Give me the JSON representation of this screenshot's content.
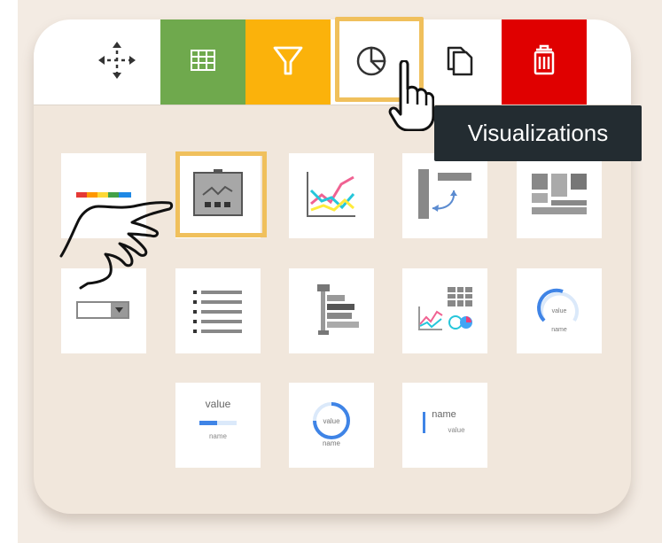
{
  "toolbar": {
    "items": [
      {
        "name": "move",
        "icon": "move-arrows-icon"
      },
      {
        "name": "table",
        "icon": "table-icon",
        "color": "#6fa94d"
      },
      {
        "name": "filter",
        "icon": "filter-icon",
        "color": "#fbb20b"
      },
      {
        "name": "visualizations",
        "icon": "pie-chart-icon",
        "selected": true
      },
      {
        "name": "copy",
        "icon": "copy-icon"
      },
      {
        "name": "delete",
        "icon": "trash-icon",
        "color": "#e00000"
      }
    ],
    "tooltip": "Visualizations"
  },
  "gallery": {
    "tiles": [
      {
        "icon": "color-bar-icon"
      },
      {
        "icon": "sparkline-icon",
        "highlighted": true
      },
      {
        "icon": "line-chart-icon"
      },
      {
        "icon": "flow-icon"
      },
      {
        "icon": "grid-layout-icon"
      },
      {
        "icon": "dropdown-icon"
      },
      {
        "icon": "list-icon"
      },
      {
        "icon": "hierarchy-icon"
      },
      {
        "icon": "dashboard-icon"
      },
      {
        "icon": "circular-gauge-icon"
      },
      {
        "icon": "linear-gauge-icon"
      },
      {
        "icon": "ring-gauge-icon"
      },
      {
        "icon": "bullet-kpi-icon"
      }
    ],
    "labels": {
      "value": "value",
      "name": "name"
    }
  },
  "colors": {
    "panel": "#f1e7dc",
    "highlight": "#f0c05c",
    "tooltip_bg": "#232c31"
  }
}
